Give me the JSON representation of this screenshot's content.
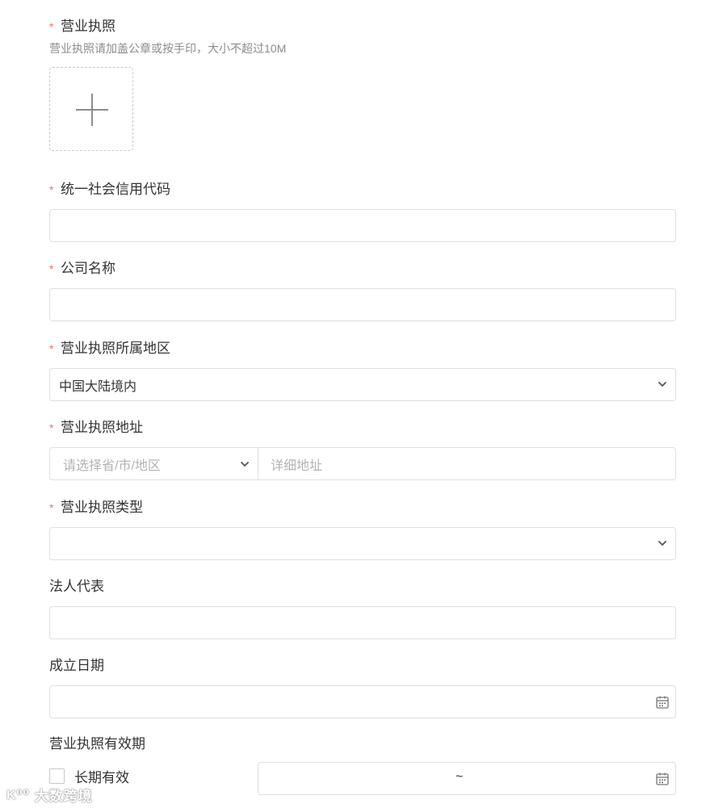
{
  "required_mark": "*",
  "license": {
    "label": "营业执照",
    "hint": "营业执照请加盖公章或按手印，大小不超过10M",
    "upload_icon": "plus-icon"
  },
  "credit_code": {
    "label": "统一社会信用代码",
    "value": ""
  },
  "company_name": {
    "label": "公司名称",
    "value": ""
  },
  "region": {
    "label": "营业执照所属地区",
    "value": "中国大陆境内"
  },
  "address": {
    "label": "营业执照地址",
    "province_placeholder": "请选择省/市/地区",
    "detail_placeholder": "详细地址"
  },
  "license_type": {
    "label": "营业执照类型",
    "value": ""
  },
  "legal_rep": {
    "label": "法人代表",
    "value": ""
  },
  "established_date": {
    "label": "成立日期",
    "value": ""
  },
  "validity": {
    "label": "营业执照有效期",
    "long_term_label": "长期有效",
    "long_term_checked": false,
    "range_separator": "~"
  },
  "watermark": {
    "logo": "K⁰⁰",
    "text": "大数跨境"
  },
  "colors": {
    "required": "#f56c6c",
    "border": "#dcdfe6",
    "text": "#333333",
    "placeholder": "#b3b3b3"
  }
}
